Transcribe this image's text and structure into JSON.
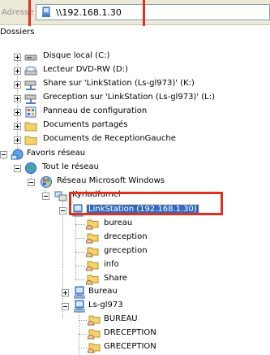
{
  "address_bar": {
    "label": "Adresse",
    "value": "\\\\192.168.1.30",
    "icon": "network-drive-icon"
  },
  "folders_panel": {
    "title": "Dossiers"
  },
  "tree": [
    {
      "label": "Disque local (C:)",
      "icon": "hard-disk-icon",
      "expander": "plus"
    },
    {
      "label": "Lecteur DVD-RW (D:)",
      "icon": "dvd-drive-icon",
      "expander": "plus"
    },
    {
      "label": "Share sur 'LinkStation (Ls-gl973)' (K:)",
      "icon": "network-share-drive-icon",
      "expander": "plus"
    },
    {
      "label": "Greception sur 'LinkStation (Ls-gl973)' (L:)",
      "icon": "network-share-drive-icon",
      "expander": "plus"
    },
    {
      "label": "Panneau de configuration",
      "icon": "control-panel-icon",
      "expander": "plus"
    },
    {
      "label": "Documents partagés",
      "icon": "folder-icon",
      "expander": "plus"
    },
    {
      "label": "Documents de ReceptionGauche",
      "icon": "folder-icon",
      "expander": "plus"
    },
    {
      "label": "Favoris réseau",
      "icon": "network-places-icon",
      "expander": "minus"
    },
    {
      "label": "Tout le réseau",
      "icon": "globe-icon",
      "expander": "minus"
    },
    {
      "label": "Réseau Microsoft Windows",
      "icon": "windows-network-icon",
      "expander": "minus"
    },
    {
      "label": "Kyriadfumel",
      "icon": "workgroup-icon",
      "expander": "minus"
    },
    {
      "label": "LinkStation (192.168.1.30)",
      "icon": "computer-icon",
      "expander": "minus",
      "selected": true
    },
    {
      "label": "bureau",
      "icon": "shared-folder-icon",
      "expander": "none"
    },
    {
      "label": "dreception",
      "icon": "shared-folder-icon",
      "expander": "none"
    },
    {
      "label": "greception",
      "icon": "shared-folder-icon",
      "expander": "none"
    },
    {
      "label": "info",
      "icon": "shared-folder-icon",
      "expander": "none"
    },
    {
      "label": "Share",
      "icon": "shared-folder-icon",
      "expander": "none"
    },
    {
      "label": "Bureau",
      "icon": "computer-icon",
      "expander": "plus"
    },
    {
      "label": "Ls-gl973",
      "icon": "computer-icon",
      "expander": "minus"
    },
    {
      "label": "BUREAU",
      "icon": "shared-folder-icon",
      "expander": "none"
    },
    {
      "label": "DRECEPTION",
      "icon": "shared-folder-icon",
      "expander": "none"
    },
    {
      "label": "GRECEPTION",
      "icon": "shared-folder-icon",
      "expander": "none"
    }
  ],
  "colors": {
    "highlight_box": "#e0301e",
    "selection": "#316ac5",
    "folder": "#f5d26b"
  }
}
